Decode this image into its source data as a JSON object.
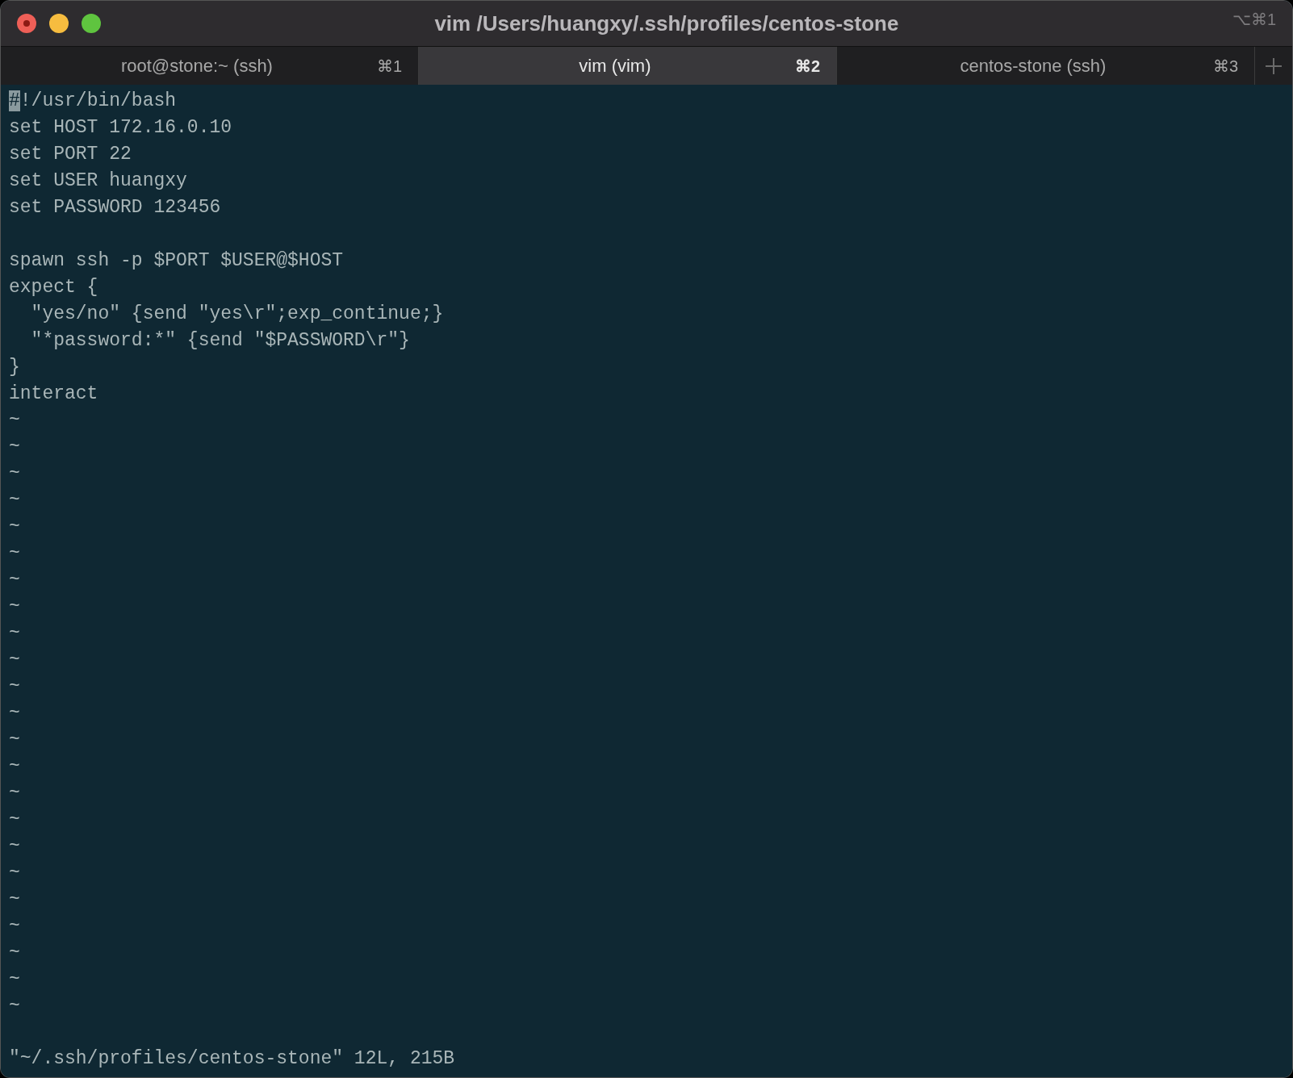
{
  "window": {
    "title": "vim /Users/huangxy/.ssh/profiles/centos-stone",
    "shortcut": "⌥⌘1"
  },
  "tabs": [
    {
      "label": "root@stone:~ (ssh)",
      "shortcut": "⌘1",
      "selected": false
    },
    {
      "label": "vim (vim)",
      "shortcut": "⌘2",
      "selected": true
    },
    {
      "label": "centos-stone (ssh)",
      "shortcut": "⌘3",
      "selected": false
    }
  ],
  "buffer": [
    {
      "kind": "code",
      "text": "#!/usr/bin/bash",
      "cursor": true
    },
    {
      "kind": "code",
      "text": "set HOST 172.16.0.10",
      "cursor": false
    },
    {
      "kind": "code",
      "text": "set PORT 22",
      "cursor": false
    },
    {
      "kind": "code",
      "text": "set USER huangxy",
      "cursor": false
    },
    {
      "kind": "code",
      "text": "set PASSWORD 123456",
      "cursor": false
    },
    {
      "kind": "blank"
    },
    {
      "kind": "code",
      "text": "spawn ssh -p $PORT $USER@$HOST",
      "cursor": false
    },
    {
      "kind": "code",
      "text": "expect {",
      "cursor": false
    },
    {
      "kind": "code",
      "text": "  \"yes/no\" {send \"yes\\r\";exp_continue;}",
      "cursor": false
    },
    {
      "kind": "code",
      "text": "  \"*password:*\" {send \"$PASSWORD\\r\"}",
      "cursor": false
    },
    {
      "kind": "code",
      "text": "}",
      "cursor": false
    },
    {
      "kind": "code",
      "text": "interact",
      "cursor": false
    },
    {
      "kind": "filler",
      "text": "~"
    },
    {
      "kind": "filler",
      "text": "~"
    },
    {
      "kind": "filler",
      "text": "~"
    },
    {
      "kind": "filler",
      "text": "~"
    },
    {
      "kind": "filler",
      "text": "~"
    },
    {
      "kind": "filler",
      "text": "~"
    },
    {
      "kind": "filler",
      "text": "~"
    },
    {
      "kind": "filler",
      "text": "~"
    },
    {
      "kind": "filler",
      "text": "~"
    },
    {
      "kind": "filler",
      "text": "~"
    },
    {
      "kind": "filler",
      "text": "~"
    },
    {
      "kind": "filler",
      "text": "~"
    },
    {
      "kind": "filler",
      "text": "~"
    },
    {
      "kind": "filler",
      "text": "~"
    },
    {
      "kind": "filler",
      "text": "~"
    },
    {
      "kind": "filler",
      "text": "~"
    },
    {
      "kind": "filler",
      "text": "~"
    },
    {
      "kind": "filler",
      "text": "~"
    },
    {
      "kind": "filler",
      "text": "~"
    },
    {
      "kind": "filler",
      "text": "~"
    },
    {
      "kind": "filler",
      "text": "~"
    },
    {
      "kind": "filler",
      "text": "~"
    },
    {
      "kind": "filler",
      "text": "~"
    }
  ],
  "status_line": "\"~/.ssh/profiles/centos-stone\" 12L, 215B"
}
